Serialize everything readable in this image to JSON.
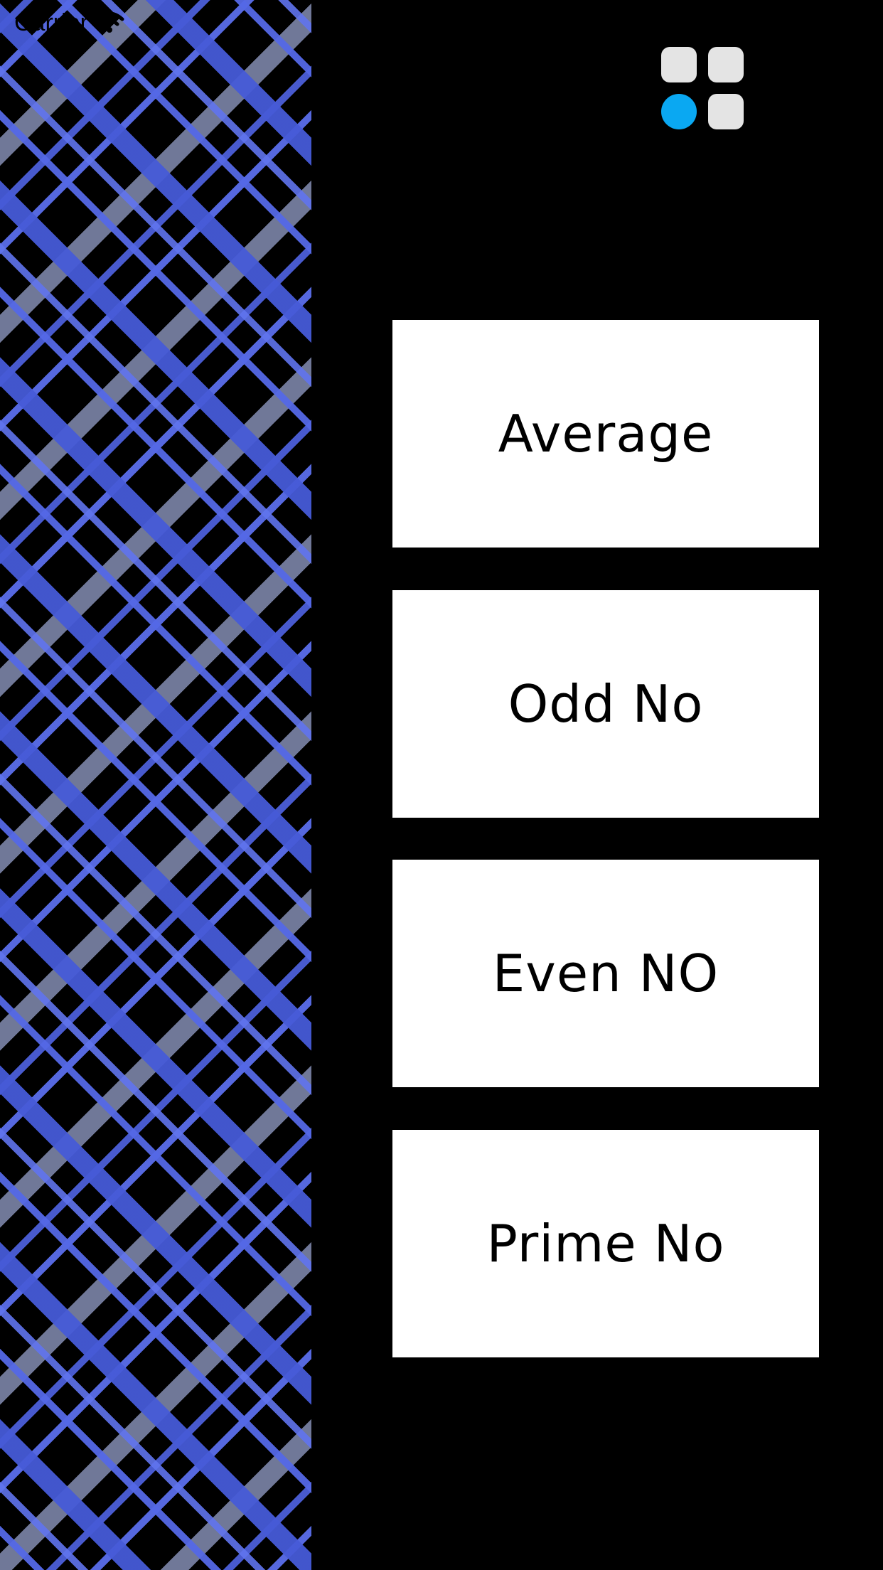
{
  "status_bar": {
    "carrier": "Carrier",
    "wifi_icon": "wifi-icon"
  },
  "menu": {
    "icon": "grid-menu-icon",
    "accent_color": "#0aa8f2",
    "tile_color": "#e4e4e4"
  },
  "buttons": [
    {
      "label": "Average"
    },
    {
      "label": "Odd No"
    },
    {
      "label": "Even NO"
    },
    {
      "label": "Prime No"
    }
  ],
  "colors": {
    "background": "#000000",
    "button_bg": "#ffffff",
    "pattern_blue": "#5468e6"
  }
}
